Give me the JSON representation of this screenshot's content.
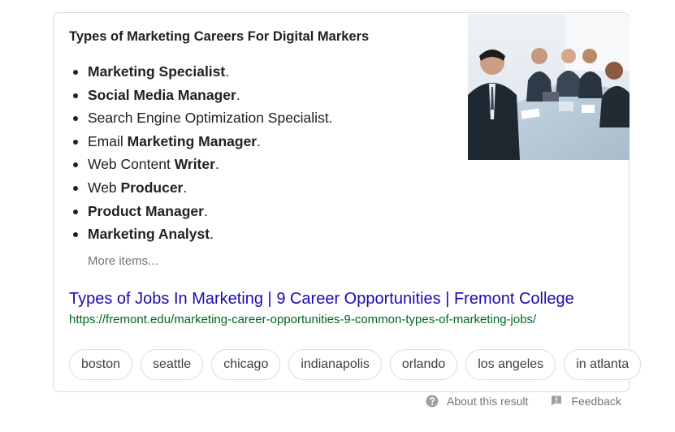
{
  "snippet": {
    "title": "Types of Marketing Careers For Digital Markers",
    "items": [
      {
        "before": "",
        "bold": "Marketing Specialist",
        "after": "."
      },
      {
        "before": "",
        "bold": "Social Media Manager",
        "after": "."
      },
      {
        "before": "Search Engine Optimization Specialist.",
        "bold": "",
        "after": ""
      },
      {
        "before": "Email ",
        "bold": "Marketing Manager",
        "after": "."
      },
      {
        "before": "Web Content ",
        "bold": "Writer",
        "after": "."
      },
      {
        "before": "Web ",
        "bold": "Producer",
        "after": "."
      },
      {
        "before": "",
        "bold": "Product Manager",
        "after": "."
      },
      {
        "before": "",
        "bold": "Marketing Analyst",
        "after": "."
      }
    ],
    "more_items": "More items..."
  },
  "result": {
    "title": "Types of Jobs In Marketing | 9 Career Opportunities | Fremont College",
    "url": "https://fremont.edu/marketing-career-opportunities-9-common-types-of-marketing-jobs/"
  },
  "chips": [
    "boston",
    "seattle",
    "chicago",
    "indianapolis",
    "orlando",
    "los angeles",
    "in atlanta"
  ],
  "footer": {
    "about": "About this result",
    "feedback": "Feedback"
  },
  "colors": {
    "link": "#1a0dab",
    "url": "#006621",
    "muted": "#70757a",
    "border": "#dadce0"
  },
  "icons": {
    "about": "help-circle-icon",
    "feedback": "feedback-flag-icon"
  }
}
